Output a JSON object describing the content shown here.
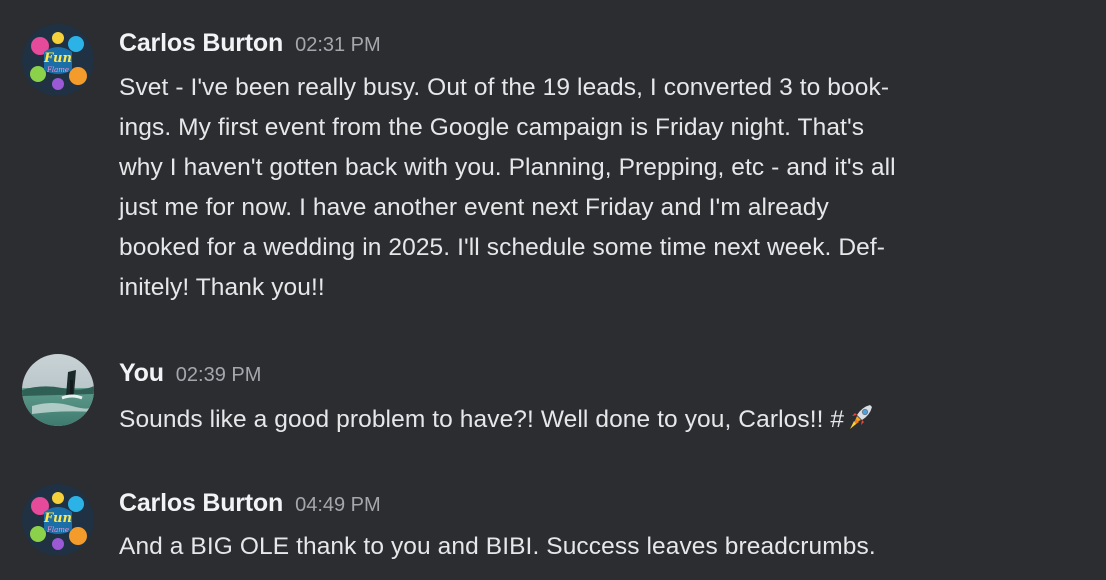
{
  "messages": [
    {
      "author": "Carlos Burton",
      "time": "02:31 PM",
      "avatar": "fun-flame-logo",
      "lines": [
        "Svet - I've been really busy.  Out of the 19 leads, I converted 3 to book-",
        "ings.  My first event from the Google campaign is Friday night.  That's",
        "why I haven't gotten back with you.  Planning, Prepping, etc - and it's all",
        "just me for now.  I have another event next Friday and I'm already",
        "booked for a wedding in 2025.   I'll schedule some time next week.  Def-",
        "initely!  Thank you!!"
      ]
    },
    {
      "author": "You",
      "time": "02:39 PM",
      "avatar": "windsurfer-photo",
      "lines": [
        "Sounds like a good problem to have?! Well done to you, Carlos!!  #"
      ],
      "emoji": "rocket-icon"
    },
    {
      "author": "Carlos Burton",
      "time": "04:49 PM",
      "avatar": "fun-flame-logo",
      "lines": [
        "And a BIG OLE thank to you and BIBI.  Success leaves breadcrumbs."
      ]
    }
  ],
  "avatar_logo_text": [
    "Fun",
    "Flame"
  ],
  "colors": {
    "background": "#2b2d31",
    "author": "#f2f3f5",
    "timestamp": "#a5a7ad",
    "text": "#e6e7e9"
  }
}
